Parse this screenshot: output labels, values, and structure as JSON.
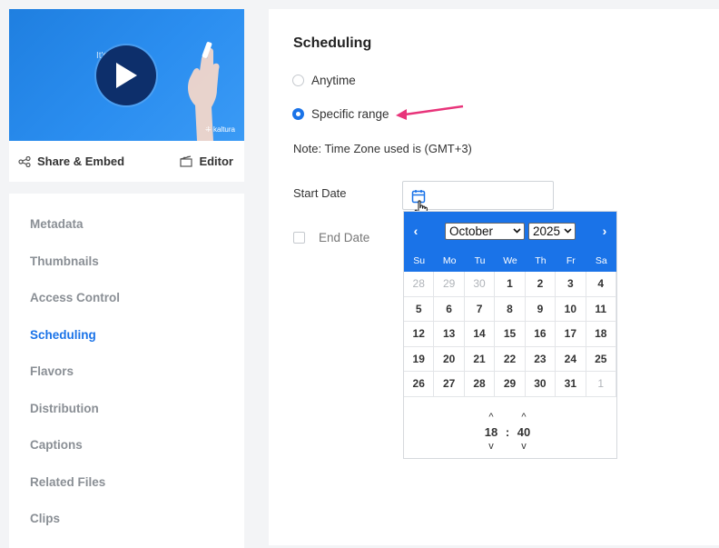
{
  "video": {
    "overlay_text": "It's as      as...",
    "brand": "kaltura",
    "share_label": "Share & Embed",
    "editor_label": "Editor"
  },
  "nav": {
    "items": [
      {
        "label": "Metadata"
      },
      {
        "label": "Thumbnails"
      },
      {
        "label": "Access Control"
      },
      {
        "label": "Scheduling"
      },
      {
        "label": "Flavors"
      },
      {
        "label": "Distribution"
      },
      {
        "label": "Captions"
      },
      {
        "label": "Related Files"
      },
      {
        "label": "Clips"
      }
    ],
    "active": "Scheduling"
  },
  "scheduling": {
    "title": "Scheduling",
    "option_anytime": "Anytime",
    "option_specific": "Specific range",
    "selected_option": "Specific range",
    "note": "Note: Time Zone used is (GMT+3)",
    "start_label": "Start Date",
    "end_label": "End Date"
  },
  "calendar": {
    "month": "October",
    "year": "2025",
    "prev": "‹",
    "next": "›",
    "weekdays": [
      "Su",
      "Mo",
      "Tu",
      "We",
      "Th",
      "Fr",
      "Sa"
    ],
    "days": [
      "28",
      "29",
      "30",
      "1",
      "2",
      "3",
      "4",
      "5",
      "6",
      "7",
      "8",
      "9",
      "10",
      "11",
      "12",
      "13",
      "14",
      "15",
      "16",
      "17",
      "18",
      "19",
      "20",
      "21",
      "22",
      "23",
      "24",
      "25",
      "26",
      "27",
      "28",
      "29",
      "30",
      "31",
      "1"
    ],
    "time": {
      "hour": "18",
      "sep": ":",
      "minute": "40",
      "up": "^",
      "down": "v"
    }
  },
  "colors": {
    "accent": "#1a73e8",
    "annotation_arrow": "#e8347a",
    "play_button": "#0d2f6b"
  }
}
